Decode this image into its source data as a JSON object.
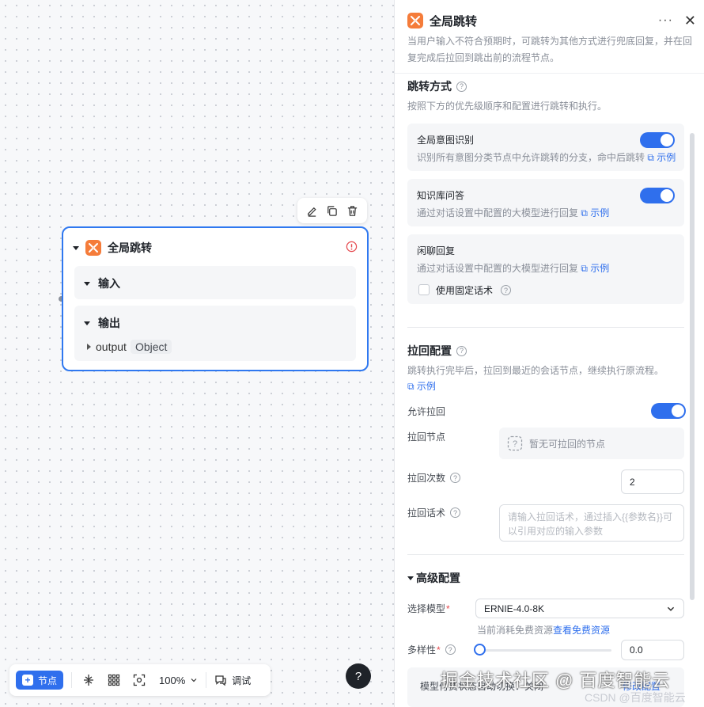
{
  "canvas": {
    "node": {
      "title": "全局跳转",
      "input_label": "输入",
      "output_label": "输出",
      "output_name": "output",
      "output_type": "Object"
    },
    "toolbar": {
      "node_label": "节点",
      "zoom": "100%",
      "debug_label": "调试"
    },
    "help": "?"
  },
  "panel": {
    "title": "全局跳转",
    "more": "···",
    "close": "✕",
    "description": "当用户输入不符合预期时，可跳转为其他方式进行兜底回复，并在回复完成后拉回到跳出前的流程节点。",
    "jump": {
      "title": "跳转方式",
      "desc": "按照下方的优先级顺序和配置进行跳转和执行。",
      "cards": [
        {
          "title": "全局意图识别",
          "desc": "识别所有意图分类节点中允许跳转的分支，命中后跳转",
          "link": "示例",
          "enabled": true
        },
        {
          "title": "知识库问答",
          "desc": "通过对话设置中配置的大模型进行回复",
          "link": "示例",
          "enabled": true
        },
        {
          "title": "闲聊回复",
          "desc": "通过对话设置中配置的大模型进行回复",
          "link": "示例",
          "checkbox_label": "使用固定话术"
        }
      ]
    },
    "pullback": {
      "title": "拉回配置",
      "desc": "跳转执行完毕后，拉回到最近的会话节点，继续执行原流程。",
      "link": "示例",
      "allow_label": "允许拉回",
      "allow_enabled": true,
      "node_label": "拉回节点",
      "node_empty": "暂无可拉回的节点",
      "count_label": "拉回次数",
      "count_value": "2",
      "script_label": "拉回话术",
      "script_placeholder": "请输入拉回话术，通过插入{{参数名}}可以引用对应的输入参数"
    },
    "advanced": {
      "title": "高级配置",
      "model_label": "选择模型",
      "model_value": "ERNIE-4.0-8K",
      "model_hint": "当前消耗免费资源",
      "model_hint_link": "查看免费资源",
      "diversity_label": "多样性",
      "diversity_value": "0.0",
      "diversity_level": 0.0,
      "fallback_label": "模型付费状态自动切换",
      "fallback_value": "关闭",
      "fallback_link": "修改配置"
    },
    "accent_color": "#2f6fed"
  },
  "watermark": {
    "main": "掘金技术社区 @ 百度智能云",
    "sub": "CSDN @百度智能云"
  }
}
